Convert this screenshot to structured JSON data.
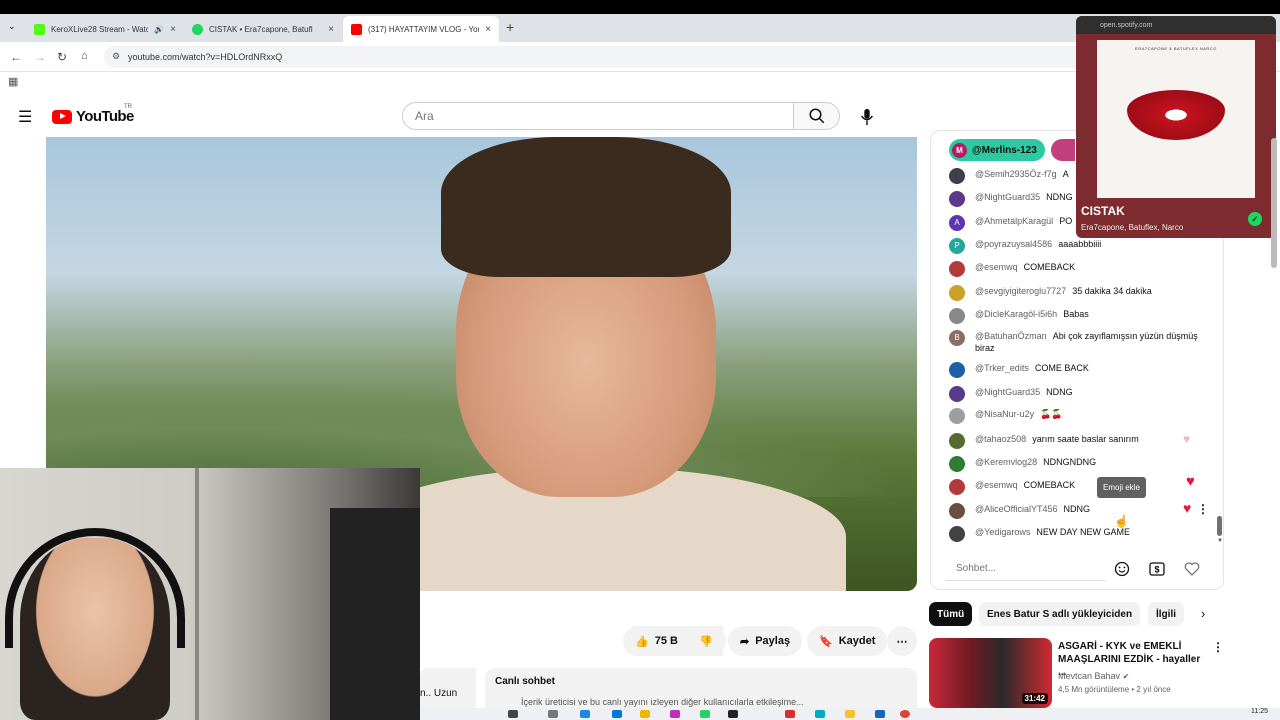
{
  "browser": {
    "tabs": [
      {
        "label": "KeroXLive28 Stream - Watc",
        "color": "#53fc18"
      },
      {
        "label": "CISTAK • Era7capone, Batufl",
        "color": "#1ed760"
      },
      {
        "label": "(317) HAYATTAYIM VLOG - You",
        "color": "#ff0000"
      }
    ],
    "url": "youtube.com/watch?v=HDLOrdNRxxQ"
  },
  "masthead": {
    "logo_text": "YouTube",
    "country_code": "TR",
    "search_placeholder": "Ara"
  },
  "video_actions": {
    "likes": "75 B",
    "share": "Paylaş",
    "save": "Kaydet"
  },
  "description": {
    "left_snippet": "n.. Uzun",
    "title": "Canlı sohbet",
    "subtitle": "İçerik üreticisi ve bu canlı yayını izleyen diğer kullanıcılarla etkileşime..."
  },
  "chat": {
    "pinned_user": "@Merlins-123",
    "pinned_initial": "M",
    "messages": [
      {
        "author": "@Semih2935Öz-f7g",
        "text": "A",
        "color": "#3d3f4a",
        "initial": ""
      },
      {
        "author": "@NightGuard35",
        "text": "NDNG",
        "color": "#5a3a8c",
        "initial": ""
      },
      {
        "author": "@AhmetalpKaragül",
        "text": "PO",
        "color": "#5e35b1",
        "initial": "A"
      },
      {
        "author": "@poyrazuysal4586",
        "text": "aaaabbbiiii",
        "color": "#26a69a",
        "initial": "P"
      },
      {
        "author": "@esemwq",
        "text": "COMEBACK",
        "color": "#b23a3a",
        "initial": ""
      },
      {
        "author": "@sevgiyigiteroglu7727",
        "text": "35 dakika 34 dakika",
        "color": "#c9a227",
        "initial": ""
      },
      {
        "author": "@DicleKaragöl-i5i6h",
        "text": "Babas",
        "color": "#888888",
        "initial": ""
      },
      {
        "author": "@BatuhanÖzman",
        "text": "Abi çok zayıflamışsın yüzün düşmüş biraz",
        "color": "#8d6e63",
        "initial": "B"
      },
      {
        "author": "@Trker_edits",
        "text": "COME BACK",
        "color": "#1e5fa8",
        "initial": ""
      },
      {
        "author": "@NightGuard35",
        "text": "NDNG",
        "color": "#5a3a8c",
        "initial": ""
      },
      {
        "author": "@NisaNur-u2y",
        "text": "🍒🍒",
        "color": "#9e9e9e",
        "initial": ""
      },
      {
        "author": "@tahaoz508",
        "text": "yarım saate baslar sanırım",
        "color": "#556b2f",
        "initial": ""
      },
      {
        "author": "@Keremvlog28",
        "text": "NDNGNDNG",
        "color": "#2e7d32",
        "initial": ""
      },
      {
        "author": "@esemwq",
        "text": "COMEBACK",
        "color": "#b23a3a",
        "initial": ""
      },
      {
        "author": "@AliceOfficialYT456",
        "text": "NDNG",
        "color": "#6d4c41",
        "initial": ""
      },
      {
        "author": "@Yedigarows",
        "text": "NEW DAY NEW GAME",
        "color": "#424242",
        "initial": ""
      }
    ],
    "tooltip": "Emoji ekle",
    "input_placeholder": "Sohbet..."
  },
  "recommendations": {
    "chips": [
      "Tümü",
      "Enes Batur S adlı yükleyiciden",
      "İlgili"
    ],
    "video": {
      "title": "ASGARİ - KYK ve EMEKLİ MAAŞLARINI EZDİK - hayaller ...",
      "channel": "Mevtcan Bahav",
      "views": "4,5 Mn görüntüleme",
      "age": "2 yıl önce",
      "duration": "31:42"
    }
  },
  "spotify": {
    "origin": "open.spotify.com",
    "cover_text": "ERA7CAPONE & BATUFLEX NARCO",
    "song": "CISTAK",
    "artists": "Era7capone, Batuflex, Narco",
    "accent": "#1ed760"
  },
  "clock": "11:25"
}
